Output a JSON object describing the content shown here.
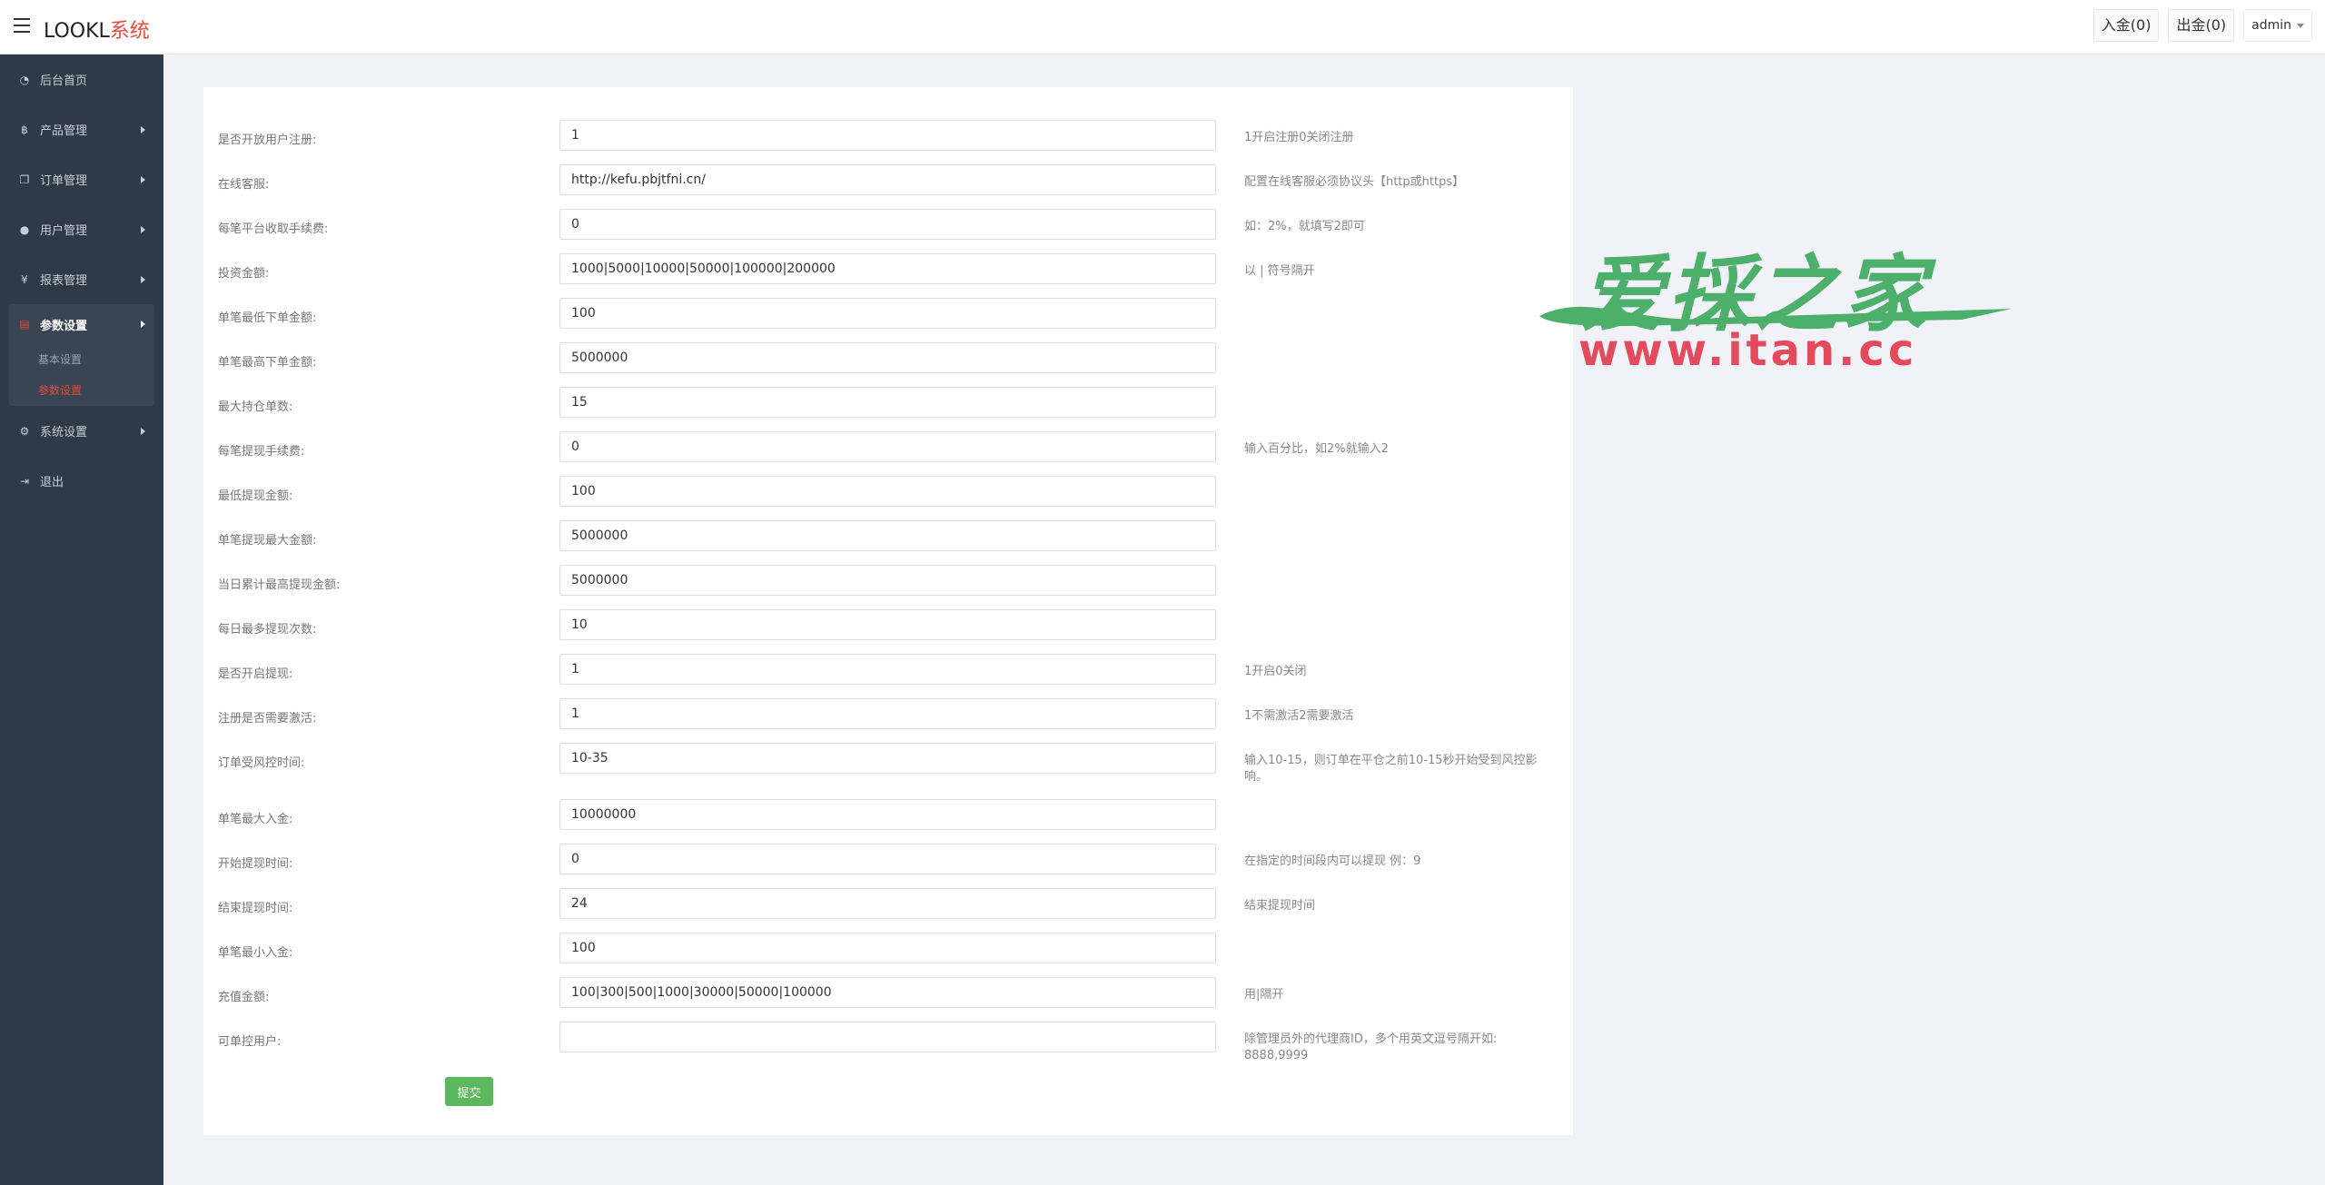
{
  "header": {
    "brand_main": "LOOKL",
    "brand_accent": "系统",
    "deposit": "入金(0)",
    "withdraw": "出金(0)",
    "user": "admin"
  },
  "sidebar": {
    "items": [
      {
        "label": "后台首页",
        "icon": "dashboard-icon"
      },
      {
        "label": "产品管理",
        "icon": "bitcoin-icon"
      },
      {
        "label": "订单管理",
        "icon": "copy-icon"
      },
      {
        "label": "用户管理",
        "icon": "user-icon"
      },
      {
        "label": "报表管理",
        "icon": "yen-icon"
      },
      {
        "label": "参数设置",
        "icon": "files-icon"
      },
      {
        "label": "系统设置",
        "icon": "gears-icon"
      },
      {
        "label": "退出",
        "icon": "sign-out-icon"
      }
    ],
    "sub_items": [
      {
        "label": "基本设置"
      },
      {
        "label": "参数设置"
      }
    ]
  },
  "form": {
    "rows": [
      {
        "label": "是否开放用户注册:",
        "value": "1",
        "hint": "1开启注册0关闭注册"
      },
      {
        "label": "在线客服:",
        "value": "http://kefu.pbjtfni.cn/",
        "hint": "配置在线客服必须协议头【http或https】"
      },
      {
        "label": "每笔平台收取手续费:",
        "value": "0",
        "hint": "如：2%，就填写2即可"
      },
      {
        "label": "投资金额:",
        "value": "1000|5000|10000|50000|100000|200000",
        "hint": "以 | 符号隔开"
      },
      {
        "label": "单笔最低下单金额:",
        "value": "100",
        "hint": ""
      },
      {
        "label": "单笔最高下单金额:",
        "value": "5000000",
        "hint": ""
      },
      {
        "label": "最大持仓单数:",
        "value": "15",
        "hint": ""
      },
      {
        "label": "每笔提现手续费:",
        "value": "0",
        "hint": "输入百分比，如2%就输入2"
      },
      {
        "label": "最低提现金额:",
        "value": "100",
        "hint": ""
      },
      {
        "label": "单笔提现最大金额:",
        "value": "5000000",
        "hint": ""
      },
      {
        "label": "当日累计最高提现金额:",
        "value": "5000000",
        "hint": ""
      },
      {
        "label": "每日最多提现次数:",
        "value": "10",
        "hint": ""
      },
      {
        "label": "是否开启提现:",
        "value": "1",
        "hint": "1开启0关闭"
      },
      {
        "label": "注册是否需要激活:",
        "value": "1",
        "hint": "1不需激活2需要激活"
      },
      {
        "label": "订单受风控时间:",
        "value": "10-35",
        "hint": "输入10-15，则订单在平仓之前10-15秒开始受到风控影响。"
      },
      {
        "label": "单笔最大入金:",
        "value": "10000000",
        "hint": ""
      },
      {
        "label": "开始提现时间:",
        "value": "0",
        "hint": "在指定的时间段内可以提现 例：9"
      },
      {
        "label": "结束提现时间:",
        "value": "24",
        "hint": "结束提现时间"
      },
      {
        "label": "单笔最小入金:",
        "value": "100",
        "hint": ""
      },
      {
        "label": "充值金额:",
        "value": "100|300|500|1000|30000|50000|100000",
        "hint": "用|隔开"
      },
      {
        "label": "可单控用户:",
        "value": "",
        "hint": "除管理员外的代理商ID，多个用英文逗号隔开如: 8888,9999"
      }
    ],
    "submit": "提交"
  },
  "watermark": {
    "cn": "爱採之家",
    "url": "www.itan.cc"
  }
}
